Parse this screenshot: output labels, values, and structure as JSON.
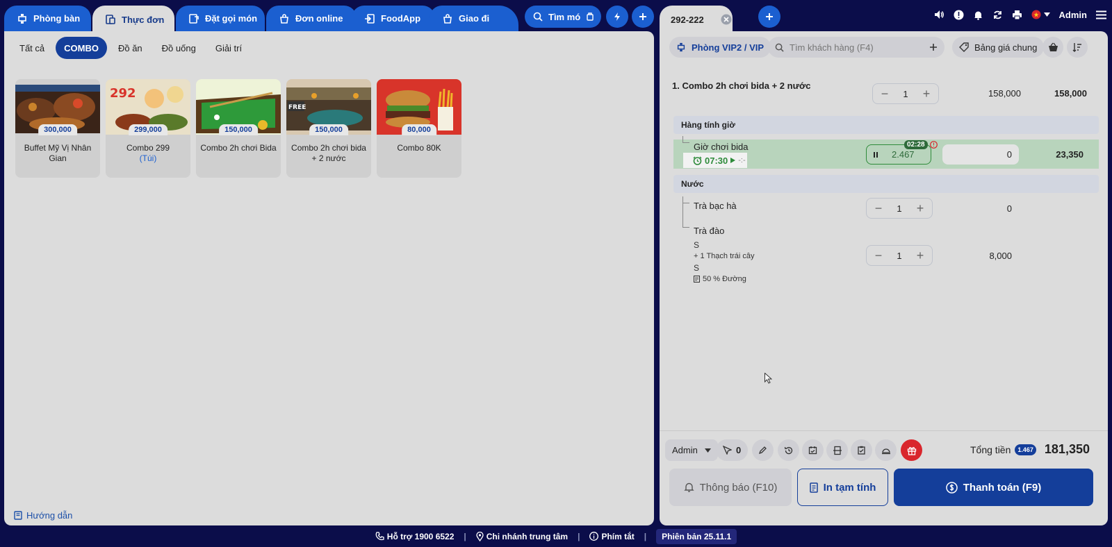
{
  "left_tabs": [
    {
      "label": "Phòng bàn",
      "icon": "table-icon"
    },
    {
      "label": "Thực đơn",
      "icon": "menu-icon"
    },
    {
      "label": "Đặt gọi món",
      "icon": "order-icon"
    },
    {
      "label": "Đơn online",
      "icon": "online-order-icon"
    },
    {
      "label": "FoodApp",
      "icon": "foodapp-icon"
    },
    {
      "label": "Giao đi",
      "icon": "delivery-icon"
    }
  ],
  "search_pill": {
    "label": "Tìm mó"
  },
  "categories": [
    "Tất cả",
    "COMBO",
    "Đồ ăn",
    "Đồ uống",
    "Giải trí"
  ],
  "active_category": "COMBO",
  "items": [
    {
      "name": "Buffet Mỹ Vị Nhân Gian",
      "price": "300,000",
      "sub": ""
    },
    {
      "name": "Combo 299",
      "price": "299,000",
      "sub": "(Túi)"
    },
    {
      "name": "Combo 2h chơi Bida",
      "price": "150,000",
      "sub": ""
    },
    {
      "name": "Combo 2h chơi bida + 2 nước",
      "price": "150,000",
      "sub": ""
    },
    {
      "name": "Combo 80K",
      "price": "80,000",
      "sub": ""
    }
  ],
  "guide_label": "Hướng dẫn",
  "order_tab": {
    "label": "292-222"
  },
  "topbar": {
    "user": "Admin"
  },
  "room_pill": "Phòng VIP2 / VIP",
  "customer_search": {
    "placeholder": "Tìm khách hàng (F4)"
  },
  "price_list": "Bảng giá chung",
  "order": {
    "line1": {
      "name": "1. Combo 2h chơi bida + 2 nước",
      "qty": "1",
      "price": "158,000",
      "total": "158,000"
    },
    "section_time": "Hàng tính giờ",
    "time_item": {
      "name": "Giờ chơi bida",
      "timer_badge": "02:28",
      "hours": "2.467",
      "start": "07:30",
      "end": "-:-",
      "qty_input": "0",
      "total": "23,350"
    },
    "section_drink": "Nước",
    "drink1": {
      "name": "Trà bạc hà",
      "qty": "1",
      "price": "0"
    },
    "drink2": {
      "name": "Trà đào",
      "qty": "1",
      "price": "8,000",
      "size": "S",
      "topping": "+ 1 Thạch trái cây",
      "size2": "S",
      "note": "50 % Đường"
    }
  },
  "footer_toolbar": {
    "user": "Admin",
    "guest_count": "0"
  },
  "total": {
    "label": "Tổng tiền",
    "badge": "1.467",
    "amount": "181,350"
  },
  "buttons": {
    "notify": "Thông báo (F10)",
    "print": "In tạm tính",
    "pay": "Thanh toán (F9)"
  },
  "status_bar": {
    "support": "Hỗ trợ 1900 6522",
    "branch": "Chi nhánh trung tâm",
    "shortcuts": "Phím tắt",
    "version": "Phiên bản 25.11.1"
  },
  "colors": {
    "primary": "#143e9a",
    "tab_blue": "#1b5fd0",
    "timer_green": "#2e8b3a",
    "gift_red": "#d9262c",
    "background": "#0b0d4a"
  }
}
